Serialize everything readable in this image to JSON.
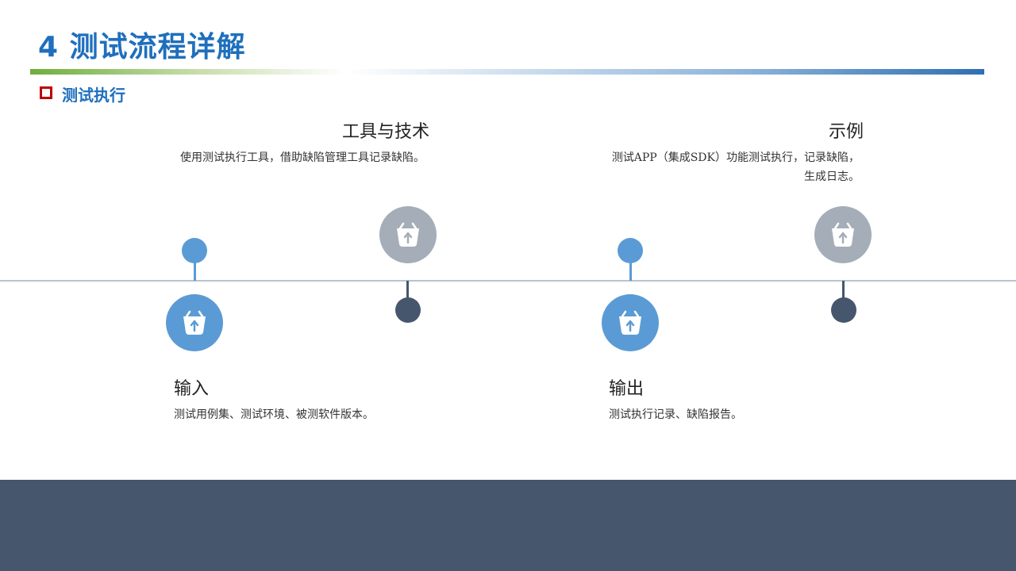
{
  "slide": {
    "title": "4 测试流程详解",
    "subtitle": "测试执行"
  },
  "colors": {
    "title_blue": "#1f6fbd",
    "marker_red": "#c00000",
    "accent_blue": "#5b9bd5",
    "accent_gray": "#a5adb8",
    "node_dark": "#46566d",
    "footer": "#46566d"
  },
  "steps": [
    {
      "heading": "输入",
      "text": "测试用例集、测试环境、被测软件版本。",
      "icon": "basket-upload-icon"
    },
    {
      "heading": "工具与技术",
      "text": "使用测试执行工具，借助缺陷管理工具记录缺陷。",
      "icon": "basket-upload-icon"
    },
    {
      "heading": "输出",
      "text": "测试执行记录、缺陷报告。",
      "icon": "basket-upload-icon"
    },
    {
      "heading": "示例",
      "text_line1": "测试APP（集成SDK）功能测试执行，记录缺陷，",
      "text_line2": "生成日志。",
      "icon": "basket-upload-icon"
    }
  ]
}
